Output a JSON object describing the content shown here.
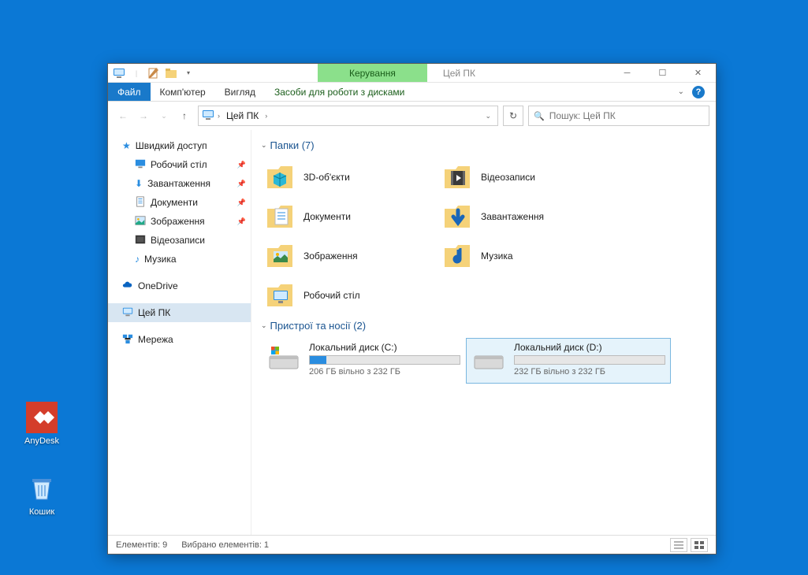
{
  "desktop": {
    "icons": [
      {
        "name": "AnyDesk",
        "tint": "#d43d2a"
      },
      {
        "name": "Кошик",
        "tint": "#ffffff"
      }
    ]
  },
  "window": {
    "context_tab": "Керування",
    "title": "Цей ПК",
    "ribbon_tabs": {
      "file": "Файл",
      "computer": "Комп'ютер",
      "view": "Вигляд",
      "drive_tools": "Засоби для роботи з дисками"
    },
    "address": {
      "root": "Цей ПК"
    },
    "search_placeholder": "Пошук: Цей ПК",
    "sidebar": {
      "quick_access": "Швидкий доступ",
      "desktop": "Робочий стіл",
      "downloads": "Завантаження",
      "documents": "Документи",
      "pictures": "Зображення",
      "videos": "Відеозаписи",
      "music": "Музика",
      "onedrive": "OneDrive",
      "this_pc": "Цей ПК",
      "network": "Мережа"
    },
    "groups": {
      "folders_header": "Папки (7)",
      "folders": [
        {
          "label": "3D-об'єкти"
        },
        {
          "label": "Відеозаписи"
        },
        {
          "label": "Документи"
        },
        {
          "label": "Завантаження"
        },
        {
          "label": "Зображення"
        },
        {
          "label": "Музика"
        },
        {
          "label": "Робочий стіл"
        }
      ],
      "drives_header": "Пристрої та носії (2)",
      "drives": [
        {
          "name": "Локальний диск (C:)",
          "free_text": "206 ГБ вільно з 232 ГБ",
          "fill_pct": 11
        },
        {
          "name": "Локальний диск (D:)",
          "free_text": "232 ГБ вільно з 232 ГБ",
          "fill_pct": 0,
          "selected": true
        }
      ]
    },
    "status": {
      "items": "Елементів: 9",
      "selected": "Вибрано елементів: 1"
    }
  }
}
